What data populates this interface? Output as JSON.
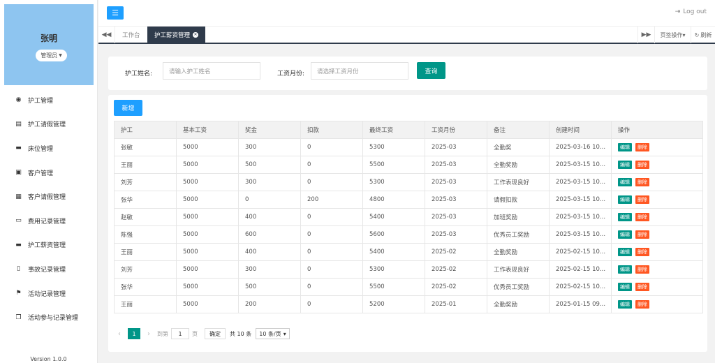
{
  "profile": {
    "name": "张明",
    "role": "管理员"
  },
  "menu": [
    {
      "icon": "user-circle-icon",
      "label": "护工管理"
    },
    {
      "icon": "list-icon",
      "label": "护工请假管理"
    },
    {
      "icon": "bed-icon",
      "label": "床位管理"
    },
    {
      "icon": "id-card-icon",
      "label": "客户管理"
    },
    {
      "icon": "calendar-check-icon",
      "label": "客户请假管理"
    },
    {
      "icon": "money-icon",
      "label": "费用记录管理"
    },
    {
      "icon": "credit-card-icon",
      "label": "护工薪资管理"
    },
    {
      "icon": "document-icon",
      "label": "事故记录管理"
    },
    {
      "icon": "flag-icon",
      "label": "活动记录管理"
    },
    {
      "icon": "copy-icon",
      "label": "活动参与记录管理"
    }
  ],
  "version": "Version 1.0.0",
  "header": {
    "logout": "Log out"
  },
  "tabs": {
    "home": "工作台",
    "active": "护工薪资管理",
    "ops": "页签操作",
    "refresh": "刷新"
  },
  "search": {
    "name_label": "护工姓名:",
    "name_placeholder": "请输入护工姓名",
    "month_label": "工资月份:",
    "month_placeholder": "请选择工资月份",
    "button": "查询"
  },
  "toolbar": {
    "add": "新增"
  },
  "table": {
    "headers": [
      "护工",
      "基本工资",
      "奖金",
      "扣款",
      "最终工资",
      "工资月份",
      "备注",
      "创建时间",
      "操作"
    ],
    "edit_label": "编辑",
    "delete_label": "删除",
    "rows": [
      [
        "张敏",
        "5000",
        "300",
        "0",
        "5300",
        "2025-03",
        "全勤奖",
        "2025-03-16 10..."
      ],
      [
        "王丽",
        "5000",
        "500",
        "0",
        "5500",
        "2025-03",
        "全勤奖励",
        "2025-03-15 10..."
      ],
      [
        "刘芳",
        "5000",
        "300",
        "0",
        "5300",
        "2025-03",
        "工作表现良好",
        "2025-03-15 10..."
      ],
      [
        "张华",
        "5000",
        "0",
        "200",
        "4800",
        "2025-03",
        "请假扣款",
        "2025-03-15 10..."
      ],
      [
        "赵敏",
        "5000",
        "400",
        "0",
        "5400",
        "2025-03",
        "加班奖励",
        "2025-03-15 10..."
      ],
      [
        "陈强",
        "5000",
        "600",
        "0",
        "5600",
        "2025-03",
        "优秀员工奖励",
        "2025-03-15 10..."
      ],
      [
        "王丽",
        "5000",
        "400",
        "0",
        "5400",
        "2025-02",
        "全勤奖励",
        "2025-02-15 10..."
      ],
      [
        "刘芳",
        "5000",
        "300",
        "0",
        "5300",
        "2025-02",
        "工作表现良好",
        "2025-02-15 10..."
      ],
      [
        "张华",
        "5000",
        "500",
        "0",
        "5500",
        "2025-02",
        "优秀员工奖励",
        "2025-02-15 10..."
      ],
      [
        "王丽",
        "5000",
        "200",
        "0",
        "5200",
        "2025-01",
        "全勤奖励",
        "2025-01-15 09..."
      ]
    ]
  },
  "pager": {
    "current": "1",
    "goto_label": "到第",
    "goto_value": "1",
    "page_unit": "页",
    "confirm": "确定",
    "total": "共 10 条",
    "page_size": "10 条/页"
  }
}
